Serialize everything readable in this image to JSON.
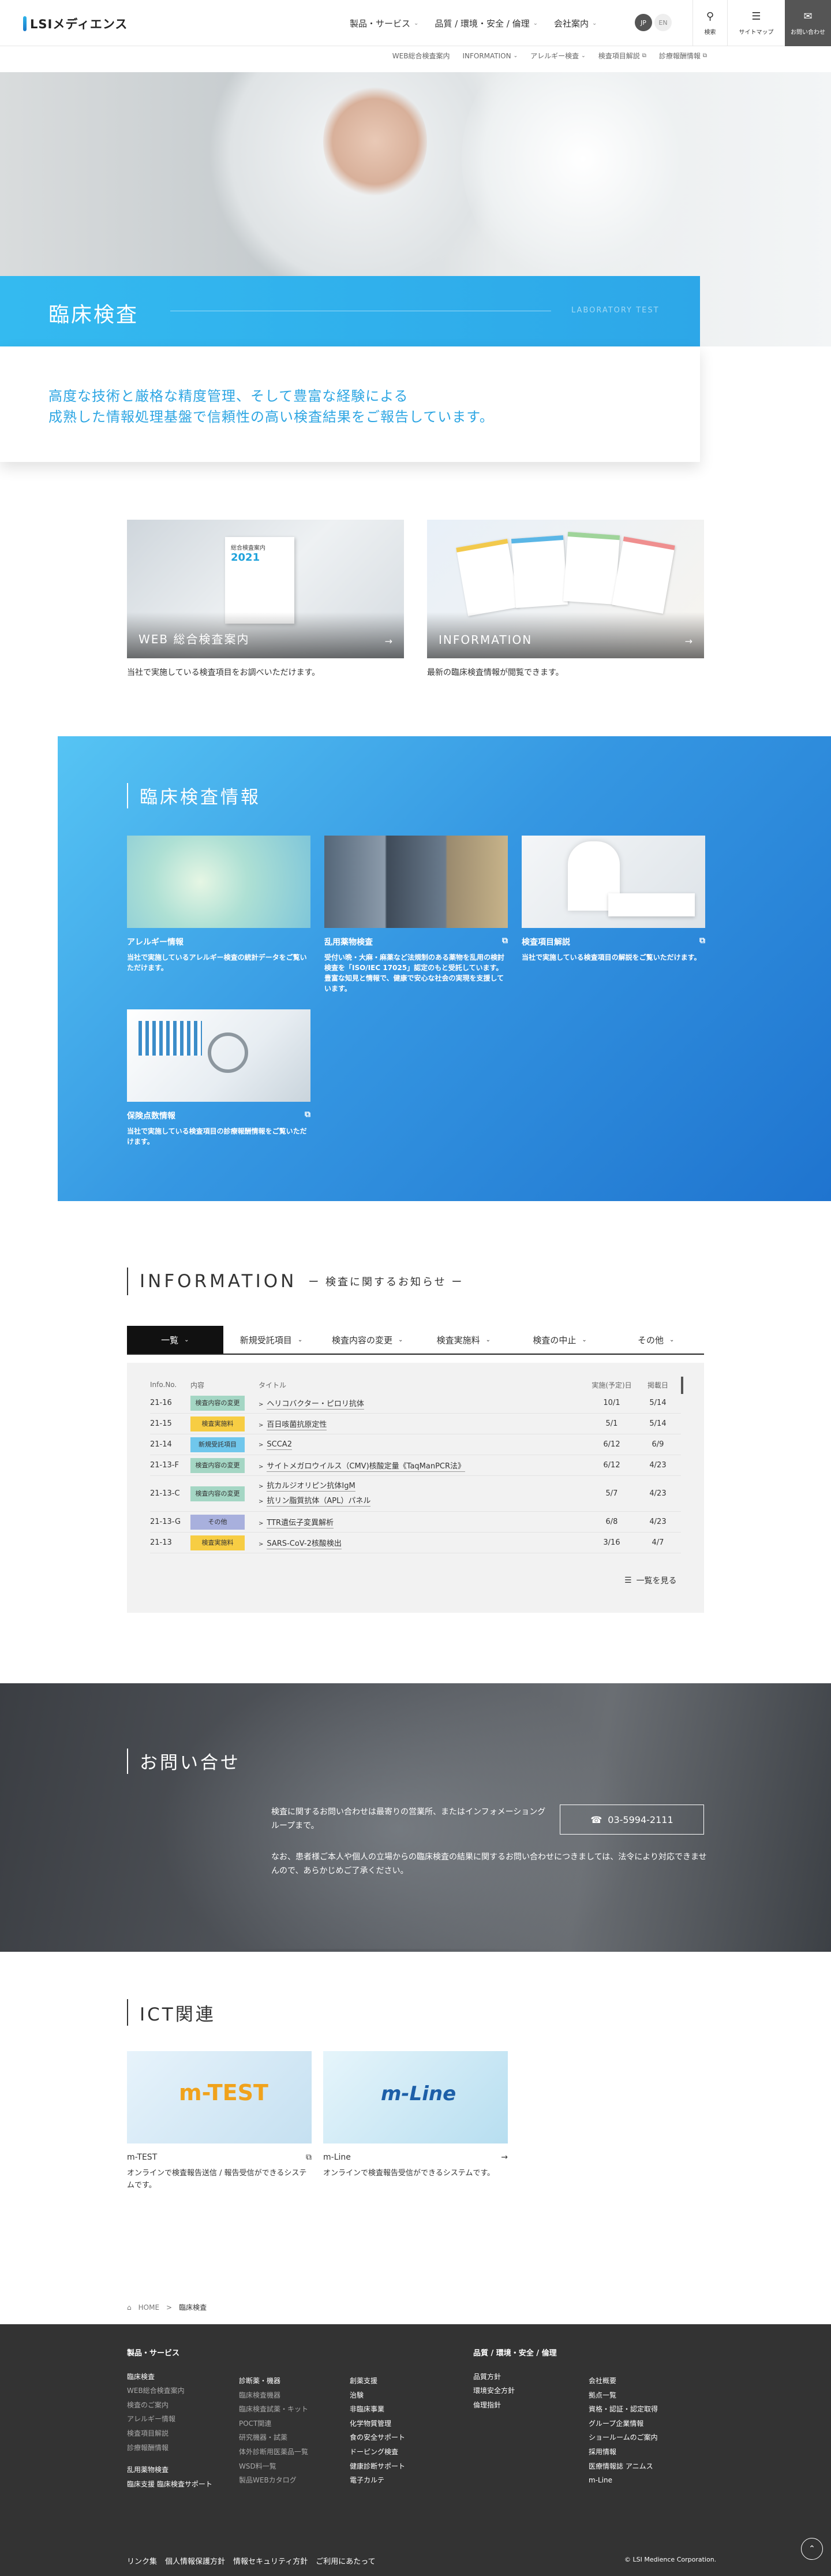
{
  "header": {
    "logo_text": "LSIメディエンス",
    "nav": [
      "製品・サービス",
      "品質 / 環境・安全 / 倫理",
      "会社案内"
    ],
    "lang_jp": "JP",
    "lang_en": "EN",
    "search_label": "検索",
    "sitemap_label": "サイトマップ",
    "contact_label": "お問い合わせ"
  },
  "subnav": [
    "WEB総合検査案内",
    "INFORMATION",
    "アレルギー検査",
    "検査項目解説",
    "診療報酬情報"
  ],
  "hero": {
    "title": "臨床検査",
    "title_en": "LABORATORY TEST",
    "intro_line1": "高度な技術と厳格な精度管理、そして豊富な経験による",
    "intro_line2": "成熟した情報処理基盤で信頼性の高い検査結果をご報告しています。"
  },
  "top_cards": [
    {
      "label": "WEB 総合検査案内",
      "desc": "当社で実施している検査項目をお調べいただけます。",
      "overlay": "総合検査案内",
      "year": "2021"
    },
    {
      "label": "INFORMATION",
      "desc": "最新の臨床検査情報が閲覧できます。"
    }
  ],
  "clinical": {
    "title": "臨床検査情報",
    "cards": [
      {
        "title": "アレルギー情報",
        "desc": "当社で実施しているアレルギー検査の統計データをご覧いただけます。"
      },
      {
        "title": "乱用薬物検査",
        "desc": "受付い晩・大麻・麻薬など法規制のある薬物を乱用の検討検査を「ISO/IEC 17025」認定のもと受託しています。豊富な知見と情報で、健康で安心な社会の実現を支援しています。"
      },
      {
        "title": "検査項目解説",
        "desc": "当社で実施している検査項目の解説をご覧いただけます。"
      },
      {
        "title": "保険点数情報",
        "desc": "当社で実施している検査項目の診療報酬情報をご覧いただけます。"
      }
    ]
  },
  "information": {
    "title": "INFORMATION",
    "subtitle": "ー 検査に関するお知らせ ー",
    "tabs": [
      "一覧",
      "新規受託項目",
      "検査内容の変更",
      "検査実施料",
      "検査の中止",
      "その他"
    ],
    "headers": [
      "Info.No.",
      "内容",
      "タイトル",
      "実施(予定)日",
      "掲載日"
    ],
    "rows": [
      {
        "no": "21-16",
        "type": "検査内容の変更",
        "color": "green",
        "titles": [
          "ヘリコバクター・ピロリ抗体"
        ],
        "date": "10/1",
        "posted": "5/14"
      },
      {
        "no": "21-15",
        "type": "検査実施料",
        "color": "yellow",
        "titles": [
          "百日咳菌抗原定性"
        ],
        "date": "5/1",
        "posted": "5/14"
      },
      {
        "no": "21-14",
        "type": "新規受託項目",
        "color": "blue",
        "titles": [
          "SCCA2"
        ],
        "date": "6/12",
        "posted": "6/9"
      },
      {
        "no": "21-13-F",
        "type": "検査内容の変更",
        "color": "green",
        "titles": [
          "サイトメガロウイルス（CMV)核酸定量《TaqManPCR法》"
        ],
        "date": "6/12",
        "posted": "4/23"
      },
      {
        "no": "21-13-C",
        "type": "検査内容の変更",
        "color": "green",
        "titles": [
          "抗カルジオリピン抗体IgM",
          "抗リン脂質抗体（APL）パネル"
        ],
        "date": "5/7",
        "posted": "4/23"
      },
      {
        "no": "21-13-G",
        "type": "その他",
        "color": "purple",
        "titles": [
          "TTR遺伝子変異解析"
        ],
        "date": "6/8",
        "posted": "4/23"
      },
      {
        "no": "21-13",
        "type": "検査実施料",
        "color": "yellow",
        "titles": [
          "SARS-CoV-2核酸検出"
        ],
        "date": "3/16",
        "posted": "4/7"
      }
    ],
    "more_label": "一覧を見る"
  },
  "contact": {
    "title": "お問い合せ",
    "text1": "検査に関するお問い合わせは最寄りの営業所、またはインフォメーショングループまで。",
    "phone": "03-5994-2111",
    "text2": "なお、患者様ご本人や個人の立場からの臨床検査の結果に関するお問い合わせにつきましては、法令により対応できませんので、あらかじめご了承ください。"
  },
  "ict": {
    "title": "ICT関連",
    "cards": [
      {
        "title": "m-TEST",
        "desc": "オンラインで検査報告送信 / 報告受信ができるシステムです。",
        "logo": "m-TEST"
      },
      {
        "title": "m-Line",
        "desc": "オンラインで検査報告受信ができるシステムです。",
        "logo": "m-Line"
      }
    ]
  },
  "breadcrumb": [
    "HOME",
    "臨床検査"
  ],
  "footer": {
    "col1_head": "製品・サービス",
    "col1": [
      "臨床検査",
      "WEB総合検査案内",
      "検査のご案内",
      "アレルギー情報",
      "検査項目解説",
      "診療報酬情報"
    ],
    "col1b": [
      "乱用薬物検査",
      "臨床支援 臨床検査サポート"
    ],
    "col2": [
      "診断薬・機器",
      "臨床検査機器",
      "臨床検査試薬・キット",
      "POCT関連",
      "研究機器・試薬",
      "体外診断用医薬品一覧",
      "WSD料一覧",
      "製品WEBカタログ"
    ],
    "col3": [
      "創薬支援",
      "治験",
      "非臨床事業",
      "化学物質管理",
      "食の安全サポート",
      "ドーピング検査",
      "健康診断サポート",
      "電子カルテ"
    ],
    "col4_head": "品質 / 環境・安全 / 倫理",
    "col4": [
      "品質方針",
      "環境安全方針",
      "倫理指針"
    ],
    "col5": [
      "会社概要",
      "拠点一覧",
      "資格・認証・認定取得",
      "グループ企業情報",
      "ショールームのご案内",
      "採用情報",
      "医療情報誌 アニムス",
      "m-Line"
    ],
    "bottom": [
      "リンク集",
      "個人情報保護方針",
      "情報セキュリティ方針",
      "ご利用にあたって"
    ],
    "copyright": "© LSI Medience Corporation."
  }
}
